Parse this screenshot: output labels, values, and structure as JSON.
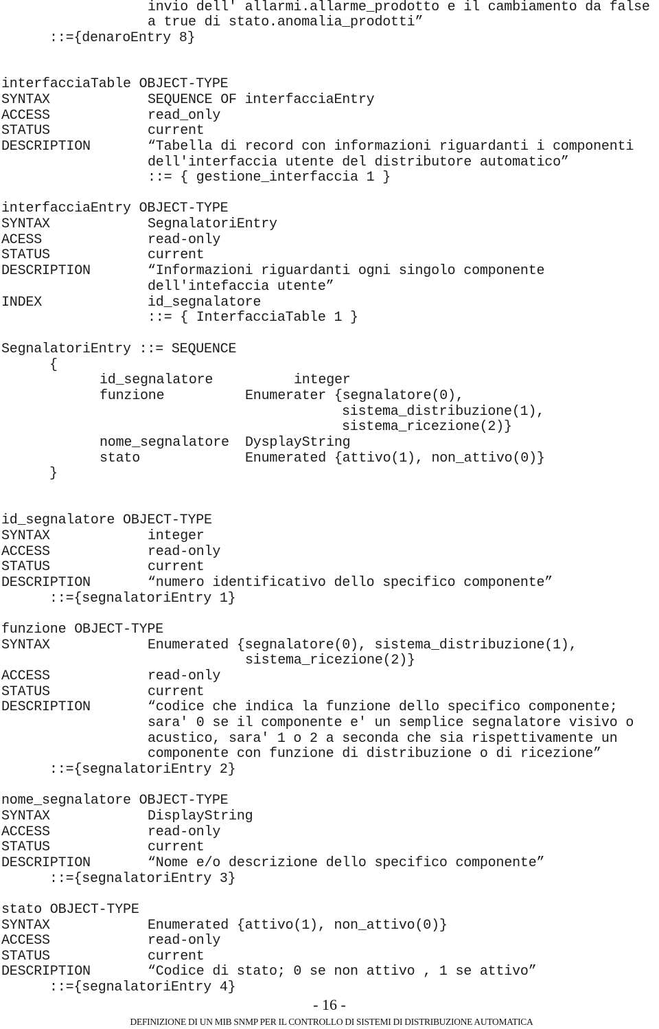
{
  "top": {
    "line1": "invio dell' allarmi.allarme_prodotto e il cambiamento da false",
    "line2": "a true di stato.anomalia_prodotti”",
    "ref": "::={denaroEntry 8}"
  },
  "interfacciaTable": {
    "header": "interfacciaTable OBJECT-TYPE",
    "syntax_label": "SYNTAX",
    "syntax": "SEQUENCE OF interfacciaEntry",
    "access_label": "ACCESS",
    "access": "read_only",
    "status_label": "STATUS",
    "status": "current",
    "description_label": "DESCRIPTION",
    "description_lines": [
      "“Tabella di record con informazioni riguardanti i componenti",
      "dell'interfaccia utente del distributore automatico”"
    ],
    "ref": "::= { gestione_interfaccia 1 }"
  },
  "interfacciaEntry": {
    "header": "interfacciaEntry OBJECT-TYPE",
    "syntax_label": "SYNTAX",
    "syntax": "SegnalatoriEntry",
    "access_label": "ACESS",
    "access": "read-only",
    "status_label": "STATUS",
    "status": "current",
    "description_label": "DESCRIPTION",
    "description_lines": [
      "“Informazioni riguardanti ogni singolo componente",
      "dell'intefaccia utente”"
    ],
    "index_label": "INDEX",
    "index": "id_segnalatore",
    "ref": "::= { InterfacciaTable 1 }"
  },
  "segnalatoriEntry": {
    "header": "SegnalatoriEntry ::= SEQUENCE",
    "open_brace": "{",
    "close_brace": "}",
    "fields": [
      {
        "name": "id_segnalatore",
        "type_lines": [
          "integer"
        ]
      },
      {
        "name": "funzione",
        "type_lines": [
          "Enumerater {segnalatore(0),",
          "sistema_distribuzione(1),",
          "sistema_ricezione(2)}"
        ]
      },
      {
        "name": "nome_segnalatore",
        "type_lines": [
          "DysplayString"
        ]
      },
      {
        "name": "stato",
        "type_lines": [
          "Enumerated {attivo(1), non_attivo(0)}"
        ]
      }
    ]
  },
  "id_segnalatore": {
    "header": "id_segnalatore OBJECT-TYPE",
    "syntax_label": "SYNTAX",
    "syntax": "integer",
    "access_label": "ACCESS",
    "access": "read-only",
    "status_label": "STATUS",
    "status": "current",
    "description_label": "DESCRIPTION",
    "description_lines": [
      "“numero identificativo dello specifico componente”"
    ],
    "ref": "::={segnalatoriEntry 1}"
  },
  "funzione": {
    "header": "funzione OBJECT-TYPE",
    "syntax_label": "SYNTAX",
    "syntax_lines": [
      "Enumerated {segnalatore(0), sistema_distribuzione(1),",
      "sistema_ricezione(2)}"
    ],
    "access_label": "ACCESS",
    "access": "read-only",
    "status_label": "STATUS",
    "status": "current",
    "description_label": "DESCRIPTION",
    "description_lines": [
      "“codice che indica la funzione dello specifico componente;",
      "sara' 0 se il componente e' un semplice segnalatore visivo o",
      "acustico, sara' 1 o 2 a seconda che sia rispettivamente un",
      "componente con funzione di distribuzione o di ricezione”"
    ],
    "ref": "::={segnalatoriEntry 2}"
  },
  "nome_segnalatore": {
    "header": "nome_segnalatore OBJECT-TYPE",
    "syntax_label": "SYNTAX",
    "syntax": "DisplayString",
    "access_label": "ACCESS",
    "access": "read-only",
    "status_label": "STATUS",
    "status": "current",
    "description_label": "DESCRIPTION",
    "description_lines": [
      "“Nome e/o descrizione dello specifico componente”"
    ],
    "ref": "::={segnalatoriEntry 3}"
  },
  "stato": {
    "header": "stato OBJECT-TYPE",
    "syntax_label": "SYNTAX",
    "syntax": "Enumerated {attivo(1), non_attivo(0)}",
    "access_label": "ACCESS",
    "access": "read-only",
    "status_label": "STATUS",
    "status": "current",
    "description_label": "DESCRIPTION",
    "description_lines": [
      "“Codice di stato; 0 se non attivo , 1 se attivo”"
    ],
    "ref": "::={segnalatoriEntry 4}"
  },
  "page_number": "- 16 -",
  "footer": "DEFINIZIONE DI UN MIB SNMP PER IL CONTROLLO DI SISTEMI DI DISTRIBUZIONE AUTOMATICA"
}
